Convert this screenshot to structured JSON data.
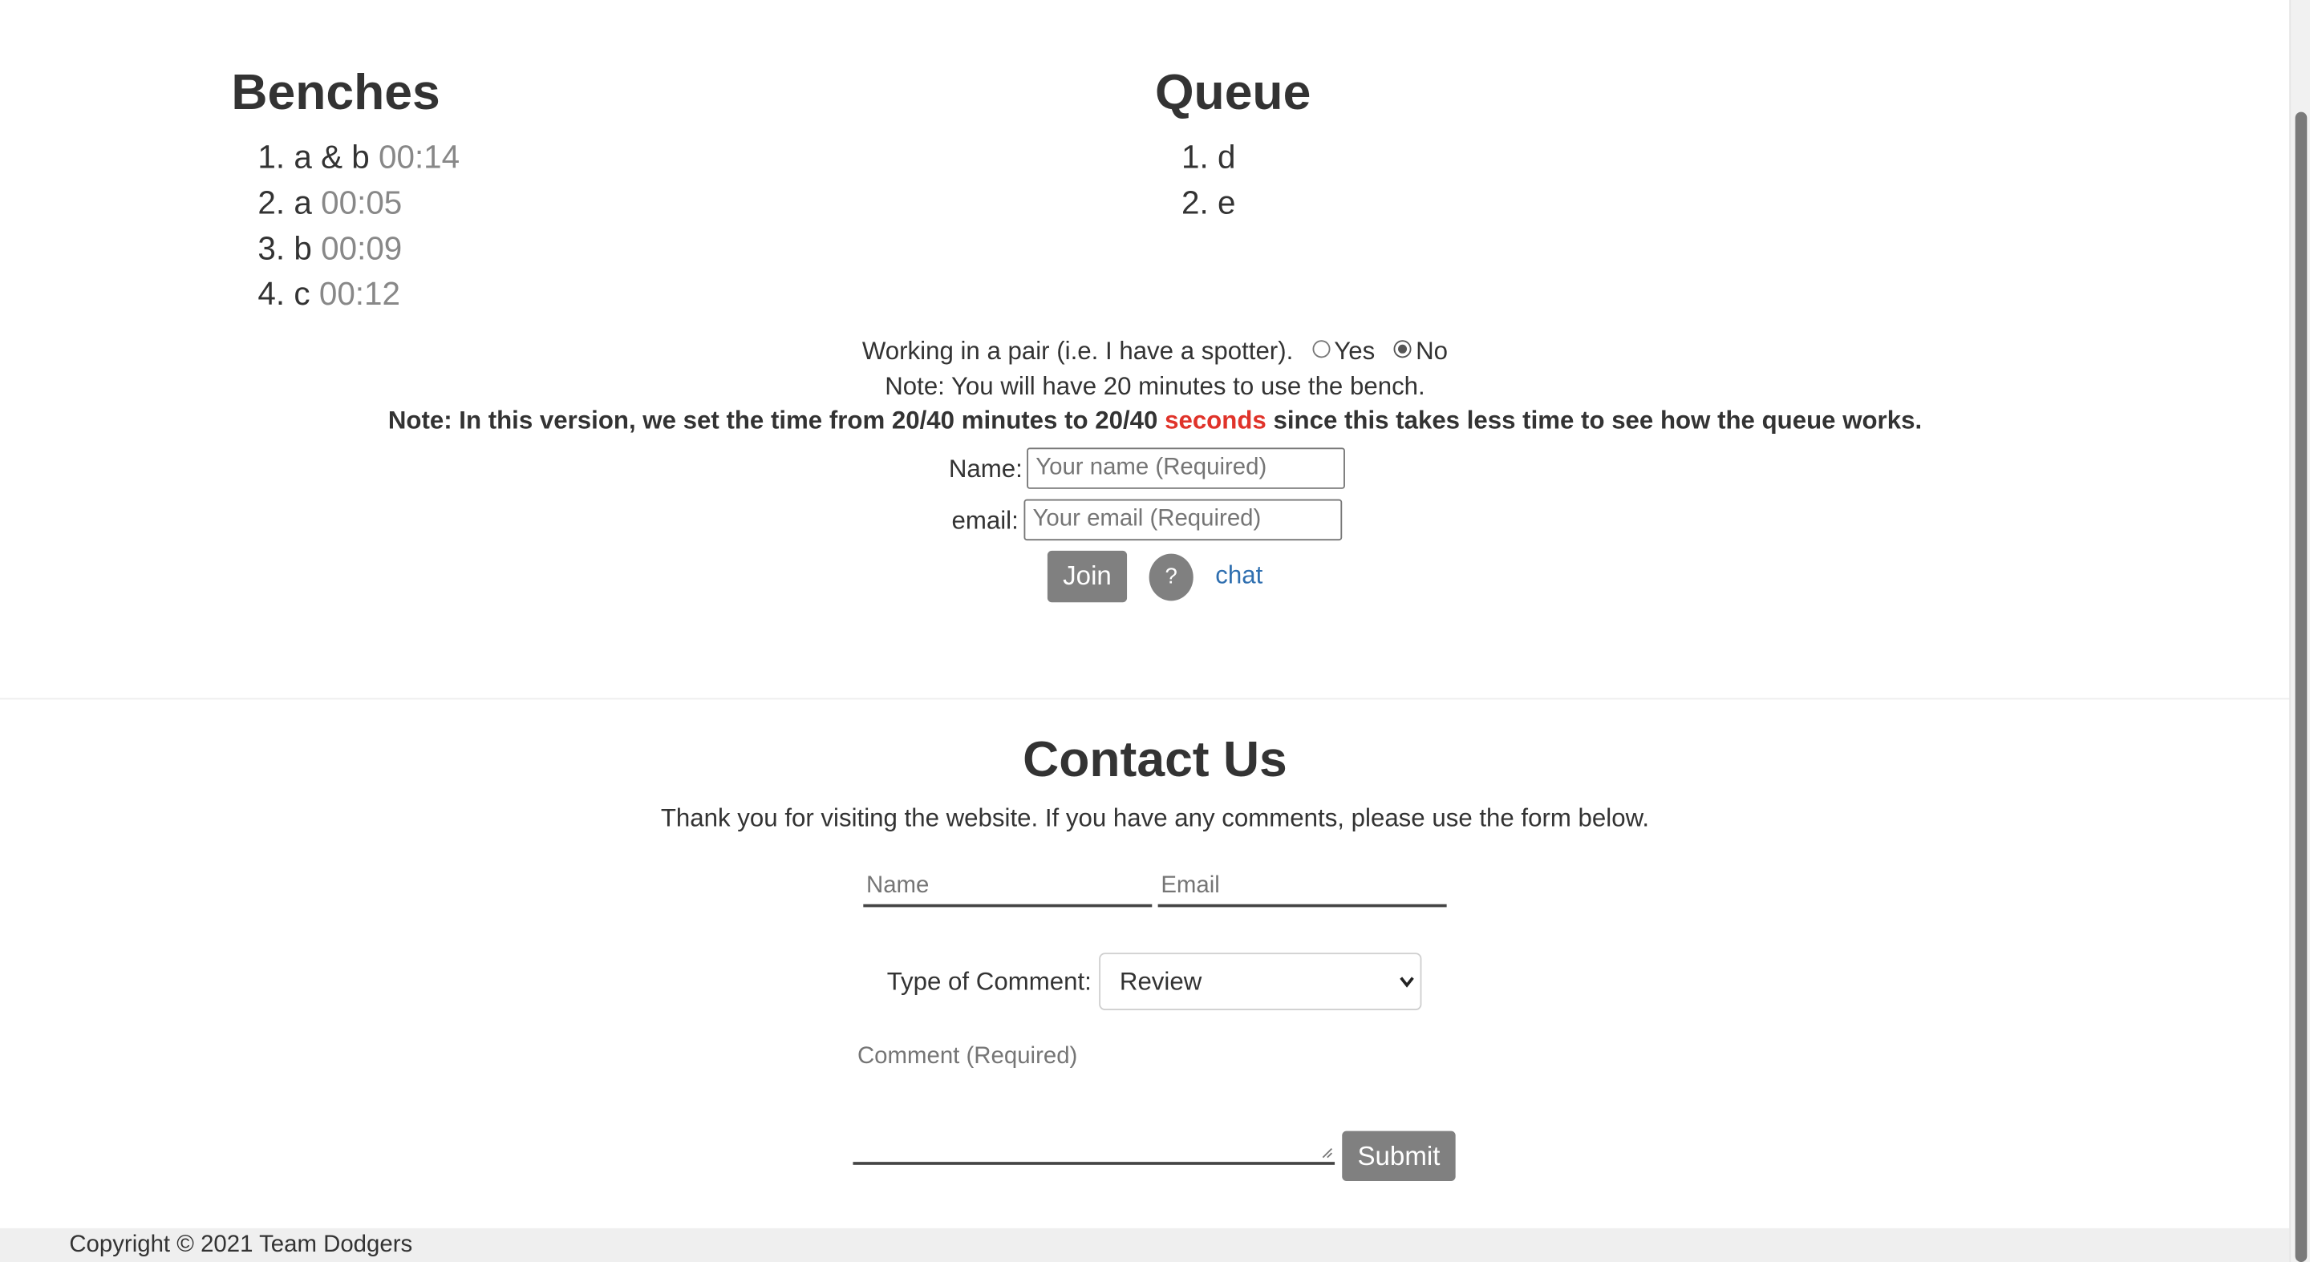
{
  "benches": {
    "title": "Benches",
    "items": [
      {
        "number": "1.",
        "name": "a & b",
        "time": "00:14"
      },
      {
        "number": "2.",
        "name": "a",
        "time": "00:05"
      },
      {
        "number": "3.",
        "name": "b",
        "time": "00:09"
      },
      {
        "number": "4.",
        "name": "c",
        "time": "00:12"
      }
    ]
  },
  "queue": {
    "title": "Queue",
    "items": [
      {
        "number": "1.",
        "name": "d"
      },
      {
        "number": "2.",
        "name": "e"
      }
    ]
  },
  "join_form": {
    "pair_prompt": "Working in a pair (i.e. I have a spotter).",
    "yes_label": "Yes",
    "no_label": "No",
    "pair_selected": "No",
    "note_time": "Note: You will have 20 minutes to use the bench.",
    "note_version_before": "Note: In this version, we set the time from 20/40 minutes to 20/40",
    "note_version_highlight": "seconds",
    "note_version_after": "since this takes less time to see how the queue works.",
    "name_label": "Name:",
    "name_placeholder": "Your name (Required)",
    "email_label": "email:",
    "email_placeholder": "Your email (Required)",
    "join_label": "Join",
    "help_label": "?",
    "chat_label": "chat"
  },
  "contact": {
    "title": "Contact Us",
    "intro": "Thank you for visiting the website. If you have any comments, please use the form below.",
    "name_placeholder": "Name",
    "email_placeholder": "Email",
    "type_label": "Type of Comment:",
    "type_selected": "Review",
    "comment_placeholder": "Comment (Required)",
    "submit_label": "Submit"
  },
  "footer": {
    "copyright": "Copyright © 2021 Team Dodgers"
  },
  "colors": {
    "highlight_red": "#e0332a",
    "button_gray": "#808080",
    "link_blue": "#2f6fb0",
    "time_gray": "#888888"
  }
}
